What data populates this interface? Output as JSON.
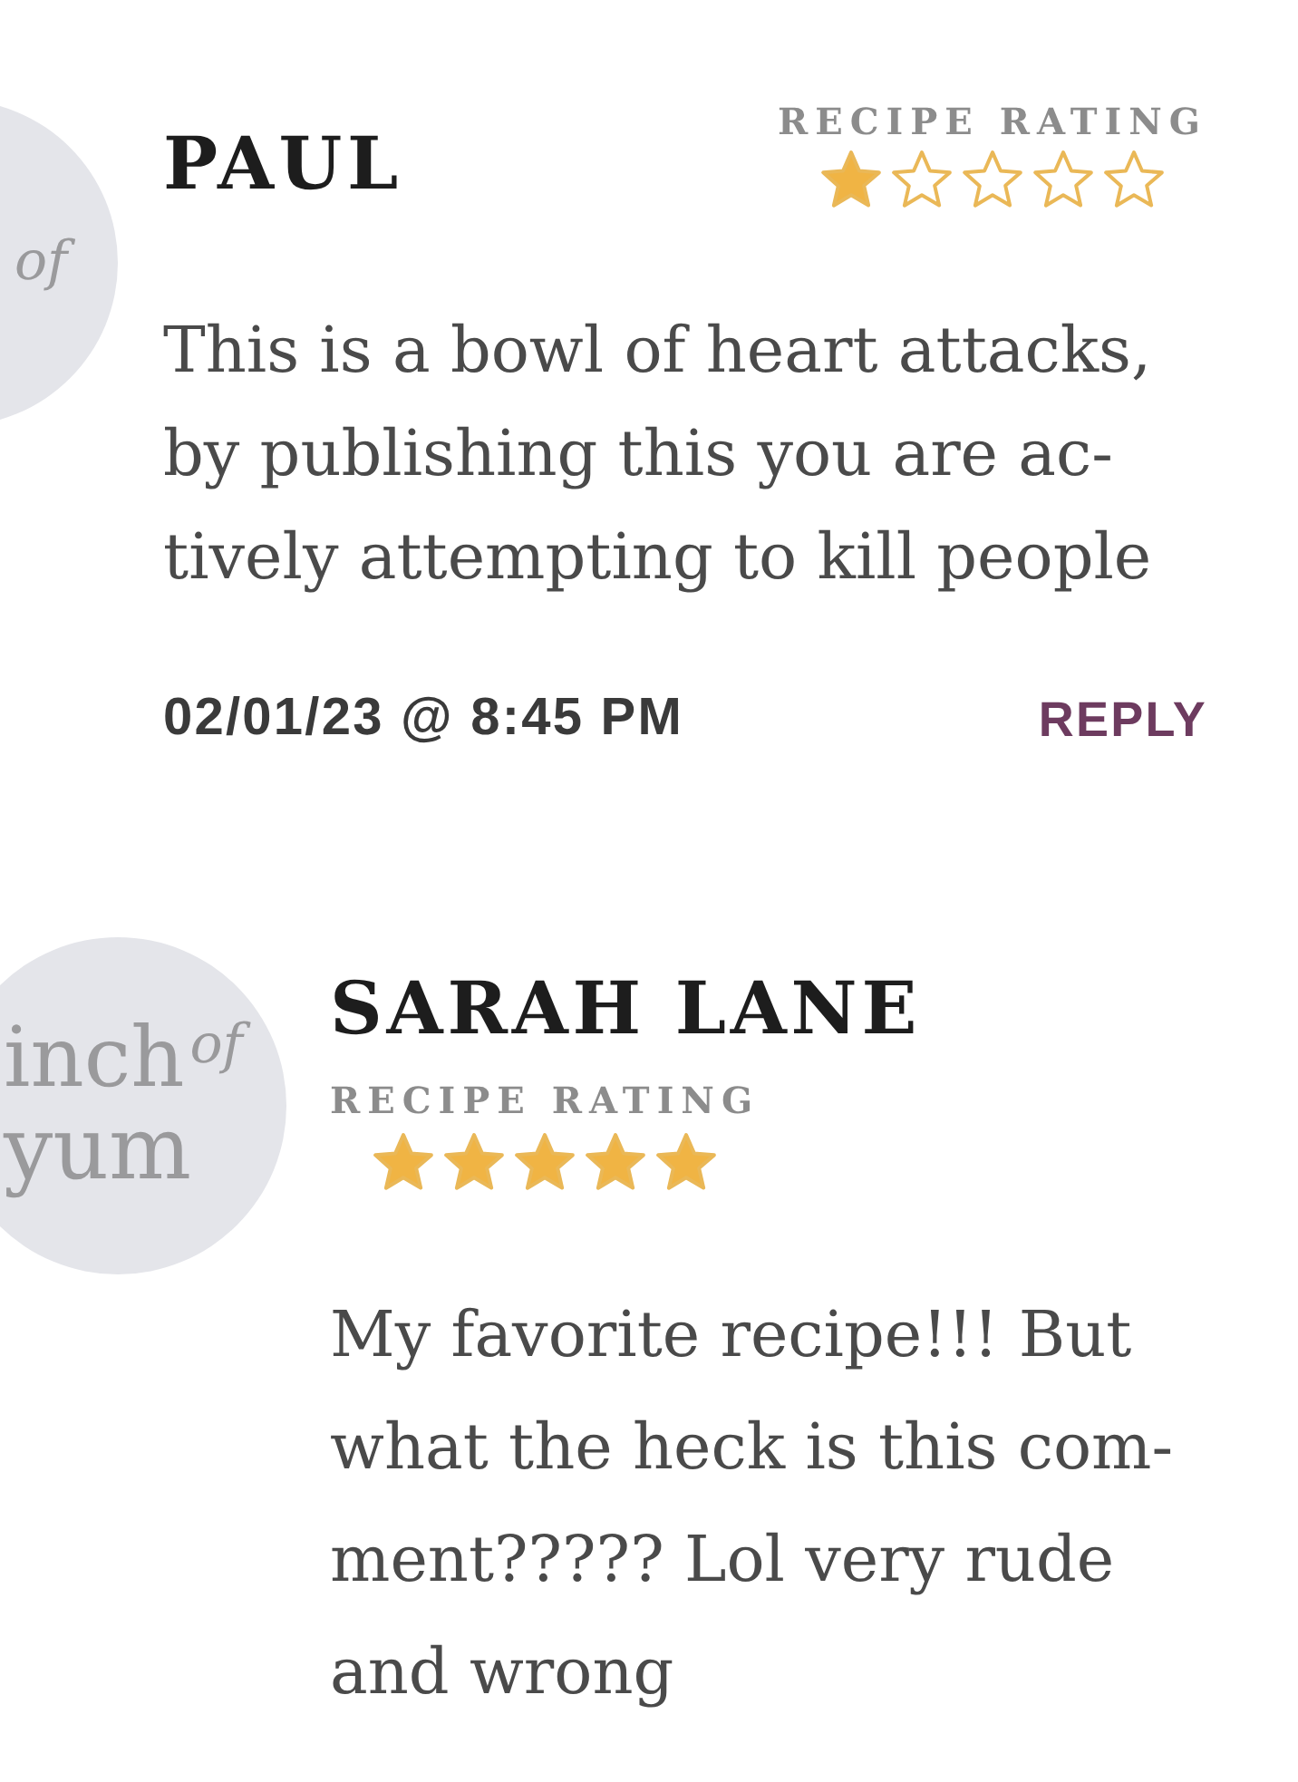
{
  "comments": [
    {
      "avatar": {
        "of": "of"
      },
      "name": "PAUL",
      "rating_label": "RECIPE RATING",
      "stars": 1,
      "body": [
        "This is a bowl of heart attacks,",
        "by publishing this you are ac-",
        "tively attempting to kill people"
      ],
      "date": "02/01/23 @ 8:45 PM",
      "reply": "REPLY"
    },
    {
      "avatar": {
        "line_1": "inch",
        "of": "of",
        "line_2": "yum"
      },
      "name": "SARAH LANE",
      "rating_label": "RECIPE RATING",
      "stars": 5,
      "body": [
        "My favorite recipe!!! But",
        "what the heck is this com-",
        "ment????? Lol very rude",
        "and wrong"
      ]
    }
  ]
}
